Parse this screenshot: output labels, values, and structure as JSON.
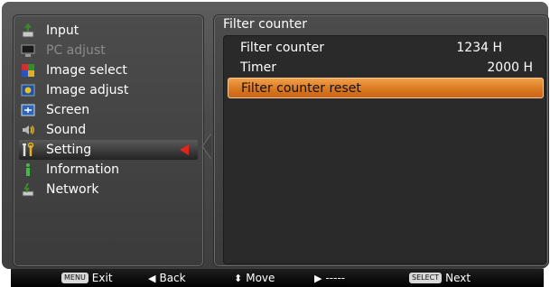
{
  "menu": {
    "items": [
      {
        "label": "Input",
        "icon": "input-icon",
        "disabled": false
      },
      {
        "label": "PC adjust",
        "icon": "pc-adjust-icon",
        "disabled": true
      },
      {
        "label": "Image select",
        "icon": "image-select-icon",
        "disabled": false
      },
      {
        "label": "Image adjust",
        "icon": "image-adjust-icon",
        "disabled": false
      },
      {
        "label": "Screen",
        "icon": "screen-icon",
        "disabled": false
      },
      {
        "label": "Sound",
        "icon": "sound-icon",
        "disabled": false
      },
      {
        "label": "Setting",
        "icon": "setting-icon",
        "disabled": false
      },
      {
        "label": "Information",
        "icon": "information-icon",
        "disabled": false
      },
      {
        "label": "Network",
        "icon": "network-icon",
        "disabled": false
      }
    ],
    "selected": "Setting"
  },
  "content": {
    "title": "Filter counter",
    "rows": [
      {
        "label": "Filter counter",
        "value": "1234 H"
      },
      {
        "label": "Timer",
        "value": "2000 H"
      },
      {
        "label": "Filter counter reset",
        "value": ""
      }
    ],
    "highlighted": "Filter counter reset"
  },
  "bottom": {
    "exit_key": "MENU",
    "exit_label": "Exit",
    "back_glyph": "◀",
    "back_label": "Back",
    "move_glyph": "⬍",
    "move_label": "Move",
    "next_glyph": "▶",
    "next_label": "-----",
    "select_key": "SELECT",
    "select_label": "Next"
  },
  "colors": {
    "highlight": "#d9761c",
    "selector_arrow": "#e0261c",
    "panel": "#3f3f3f"
  }
}
